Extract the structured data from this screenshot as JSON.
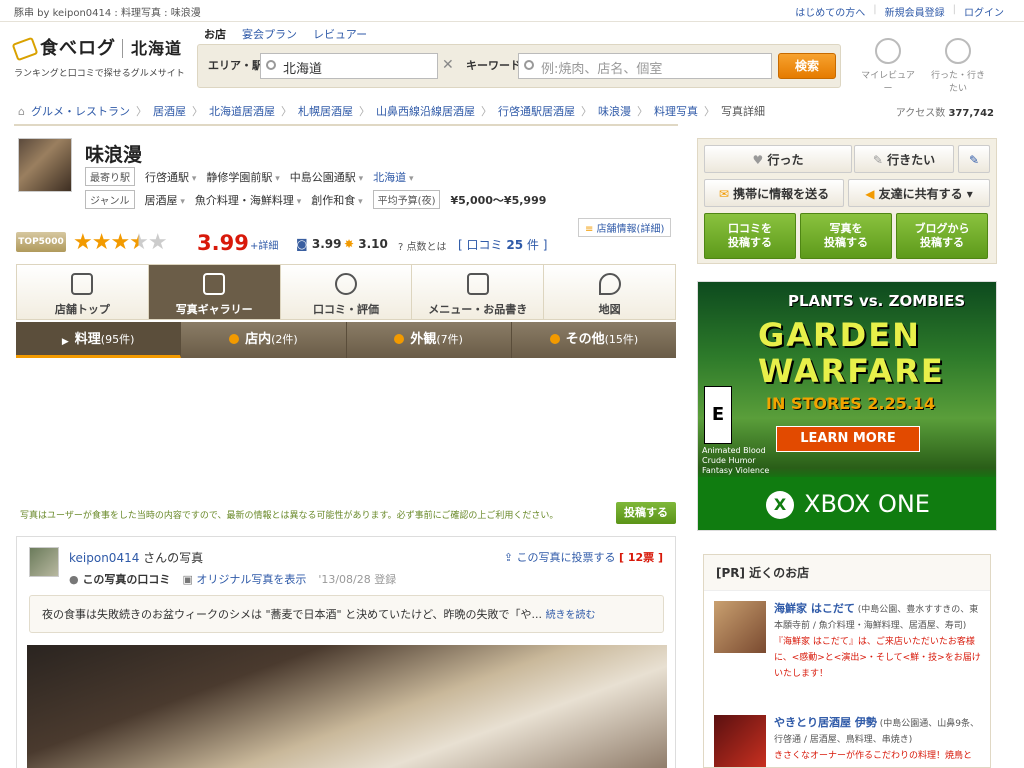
{
  "topbar": {
    "crumb": "豚串 by keipon0414 : 料理写真 : 味浪漫",
    "links": [
      "はじめての方へ",
      "新規会員登録",
      "ログイン"
    ]
  },
  "logo": {
    "name": "食べログ",
    "region": "北海道",
    "tagline": "ランキングと口コミで探せるグルメサイト"
  },
  "search": {
    "tabs": [
      "お店",
      "宴会プラン",
      "レビュアー"
    ],
    "area_label": "エリア・駅",
    "area_value": "北海道",
    "keyword_label": "キーワード",
    "keyword_placeholder": "例:焼肉、店名、個室",
    "button": "検索"
  },
  "header_icons": {
    "my_reviewer": "マイレビュアー",
    "went_wanted": "行った・行きたい"
  },
  "breadcrumb": [
    "グルメ・レストラン",
    "居酒屋",
    "北海道居酒屋",
    "札幌居酒屋",
    "山鼻西線沿線居酒屋",
    "行啓通駅居酒屋",
    "味浪漫",
    "料理写真",
    "写真詳細"
  ],
  "access": {
    "label": "アクセス数",
    "count": "377,742"
  },
  "shop": {
    "name": "味浪漫",
    "station_tag": "最寄り駅",
    "stations": [
      "行啓通駅",
      "静修学園前駅",
      "中島公園通駅"
    ],
    "region": "北海道",
    "genre_tag": "ジャンル",
    "genres": [
      "居酒屋",
      "魚介料理・海鮮料理",
      "創作和食"
    ],
    "budget_tag": "平均予算(夜)",
    "budget": "¥5,000～¥5,999",
    "detail_link": "店舗情報(詳細)"
  },
  "rating": {
    "badge": "TOP5000",
    "stars": 3.5,
    "score": "3.99",
    "detail": "+詳細",
    "night_score": "3.99",
    "lunch_score": "3.10",
    "points_label": "点数とは",
    "review_label": "口コミ",
    "review_count": "25",
    "review_unit": "件"
  },
  "main_tabs": [
    "店舗トップ",
    "写真ギャラリー",
    "口コミ・評価",
    "メニュー・お品書き",
    "地図"
  ],
  "sub_tabs": [
    {
      "label": "料理",
      "count": "(95件)"
    },
    {
      "label": "店内",
      "count": "(2件)"
    },
    {
      "label": "外観",
      "count": "(7件)"
    },
    {
      "label": "その他",
      "count": "(15件)"
    }
  ],
  "notice": "写真はユーザーが食事をした当時の内容ですので、最新の情報とは異なる可能性があります。必ず事前にご確認の上ご利用ください。",
  "post_button": "投稿する",
  "photo_card": {
    "user": "keipon0414",
    "user_suffix": "さんの写真",
    "vote_link": "この写真に投票する",
    "vote_count": "[ 12票 ]",
    "review_link": "この写真の口コミ",
    "original_link": "オリジナル写真を表示",
    "date": "'13/08/28 登録",
    "quote": "夜の食事は失敗続きのお盆ウィークのシメは \"蕎麦で日本酒\" と決めていたけど、昨晩の失敗で「や...",
    "read_more": "続きを読む"
  },
  "actions": {
    "went": "行った",
    "want": "行きたい",
    "send": "携帯に情報を送る",
    "share": "友達に共有する",
    "post_review": "口コミを\n投稿する",
    "post_photo": "写真を\n投稿する",
    "post_blog": "ブログから\n投稿する"
  },
  "ad": {
    "brand": "PLANTS vs. ZOMBIES",
    "title1": "GARDEN",
    "title2": "WARFARE",
    "date": "IN STORES 2.25.14",
    "cta": "LEARN MORE",
    "rating": "E",
    "descriptors": [
      "Animated Blood",
      "Crude Humor",
      "Fantasy Violence"
    ],
    "platform": "XBOX ONE"
  },
  "nearby": {
    "title": "[PR] 近くのお店",
    "items": [
      {
        "name": "海鮮家 はこだて",
        "info": "(中島公園、豊水すすきの、東本願寺前 / 魚介料理・海鮮料理、居酒屋、寿司)",
        "promo": "『海鮮家 はこだて』は、ご来店いただいたお客様に、<感動>と<演出>・そして<鮮・技>をお届けいたします！"
      },
      {
        "name": "やきとり居酒屋 伊勢",
        "info": "(中島公園通、山鼻9条、行啓通 / 居酒屋、鳥料理、串焼き)",
        "promo": "きさくなオーナーが作るこだわりの料理！焼鳥と"
      }
    ]
  }
}
